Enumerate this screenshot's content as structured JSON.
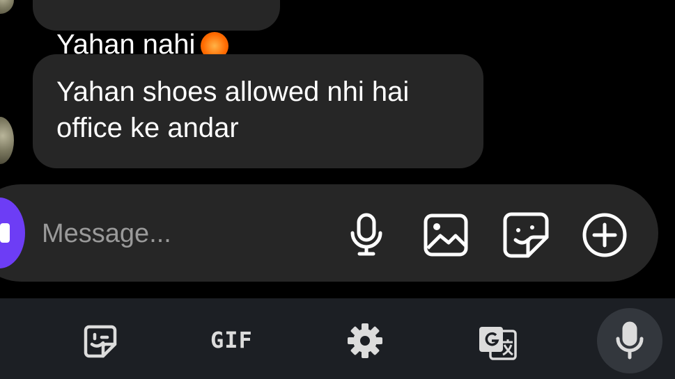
{
  "messages": [
    {
      "text": "Yahan nahi",
      "partial": true
    },
    {
      "text": "Yahan shoes allowed nhi hai\noffice ke andar"
    }
  ],
  "composer": {
    "placeholder": "Message..."
  },
  "keyboard_toolbar": {
    "gif_label": "GIF"
  },
  "colors": {
    "background": "#000000",
    "bubble": "#262626",
    "composer": "#262626",
    "keyboard_bar": "#1c1f24",
    "accent": "#6d3df5"
  },
  "icons": {
    "composer": [
      "mic-icon",
      "image-icon",
      "sticker-icon",
      "plus-circle-icon"
    ],
    "keyboard": [
      "sticker-icon",
      "gif-icon",
      "settings-icon",
      "translate-icon",
      "mic-icon"
    ]
  }
}
